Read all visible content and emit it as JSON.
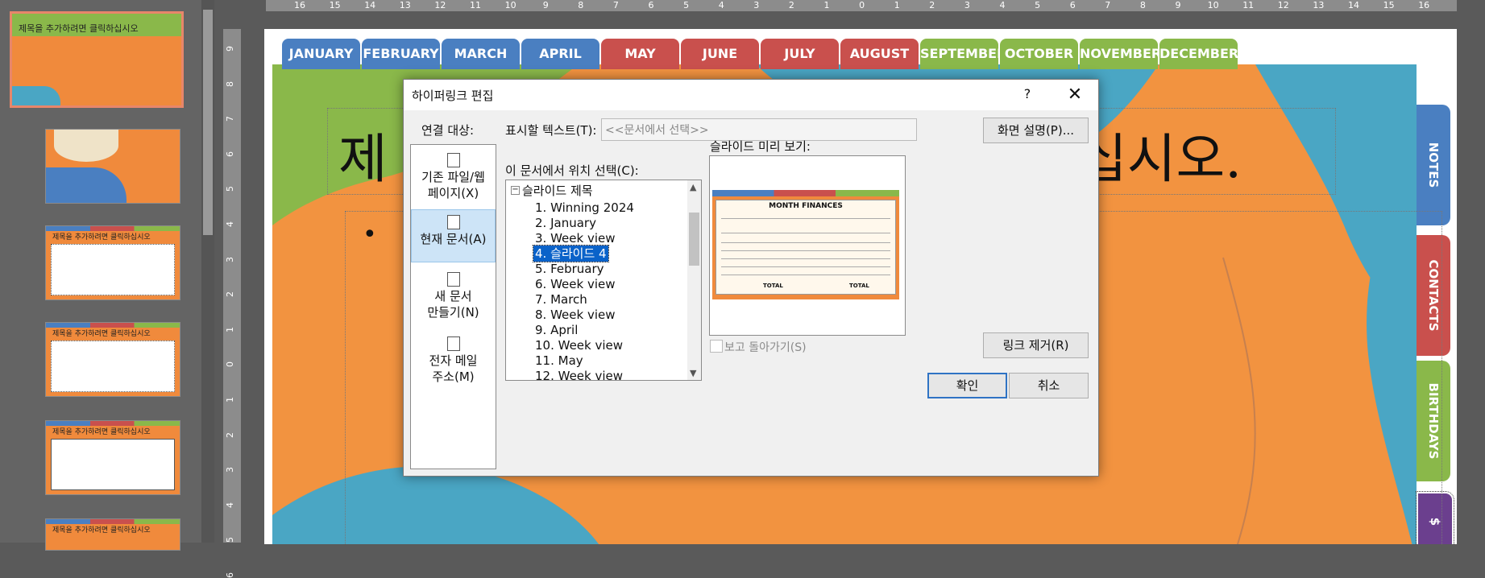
{
  "thumbnail_pane": {
    "selected_thumb_title": "제목을 추가하려면 클릭하십시오",
    "thumb_titles": [
      "제목을 추가하려면 클릭하십시오",
      "제목을 추가하려면 클릭하십시오",
      "제목을 추가하려면 클릭하십시오",
      "제목을 추가하려면 클릭하십시오"
    ]
  },
  "ruler": {
    "horizontal": [
      "16",
      "15",
      "14",
      "13",
      "12",
      "11",
      "10",
      "9",
      "8",
      "7",
      "6",
      "5",
      "4",
      "3",
      "2",
      "1",
      "0",
      "1",
      "2",
      "3",
      "4",
      "5",
      "6",
      "7",
      "8",
      "9",
      "10",
      "11",
      "12",
      "13",
      "14",
      "15",
      "16"
    ],
    "vertical": [
      "9",
      "8",
      "7",
      "6",
      "5",
      "4",
      "3",
      "2",
      "1",
      "0",
      "1",
      "2",
      "3",
      "4",
      "5",
      "6"
    ]
  },
  "slide": {
    "month_tabs": [
      {
        "label": "JANUARY",
        "color": "#4a7fc1"
      },
      {
        "label": "FEBRUARY",
        "color": "#4a7fc1"
      },
      {
        "label": "MARCH",
        "color": "#4a7fc1"
      },
      {
        "label": "APRIL",
        "color": "#4a7fc1"
      },
      {
        "label": "MAY",
        "color": "#c9504d"
      },
      {
        "label": "JUNE",
        "color": "#c9504d"
      },
      {
        "label": "JULY",
        "color": "#c9504d"
      },
      {
        "label": "AUGUST",
        "color": "#c9504d"
      },
      {
        "label": "SEPTEMBER",
        "color": "#8ab84a"
      },
      {
        "label": "OCTOBER",
        "color": "#8ab84a"
      },
      {
        "label": "NOVEMBER",
        "color": "#8ab84a"
      },
      {
        "label": "DECEMBER",
        "color": "#8ab84a"
      }
    ],
    "side_tabs": [
      {
        "label": "NOTES",
        "color": "#4a7fc1"
      },
      {
        "label": "CONTACTS",
        "color": "#c9504d"
      },
      {
        "label": "BIRTHDAYS",
        "color": "#8ab84a"
      },
      {
        "label": "$",
        "color": "#6b3f8e"
      }
    ],
    "title_left": "제",
    "title_right": "십시오.",
    "bullet": "•"
  },
  "dialog": {
    "title": "하이퍼링크 편집",
    "help": "?",
    "close": "✕",
    "link_to_label": "연결 대상:",
    "nav_items": [
      {
        "label_1": "기존 파일/웹",
        "label_2": "페이지(X)"
      },
      {
        "label_1": "현재 문서(A)",
        "label_2": ""
      },
      {
        "label_1": "새 문서",
        "label_2": "만들기(N)"
      },
      {
        "label_1": "전자 메일",
        "label_2": "주소(M)"
      }
    ],
    "display_text_label": "표시할 텍스트(T):",
    "display_text_value": "<<문서에서 선택>>",
    "screentip_button": "화면 설명(P)...",
    "place_label": "이 문서에서 위치 선택(C):",
    "tree_root": "슬라이드 제목",
    "tree_toggle": "−",
    "tree_items": [
      "1. Winning 2024",
      "2. January",
      "3. Week view",
      "4. 슬라이드 4",
      "5. February",
      "6. Week view",
      "7. March",
      "8. Week view",
      "9. April",
      "10. Week view",
      "11. May",
      "12. Week view"
    ],
    "selected_index": 3,
    "preview_label": "슬라이드 미리 보기:",
    "preview_slide_title": "MONTH FINANCES",
    "preview_total_1": "TOTAL",
    "preview_total_2": "TOTAL",
    "show_return_label": "보고 돌아가기(S)",
    "remove_link_button": "링크 제거(R)",
    "ok_button": "확인",
    "cancel_button": "취소"
  }
}
